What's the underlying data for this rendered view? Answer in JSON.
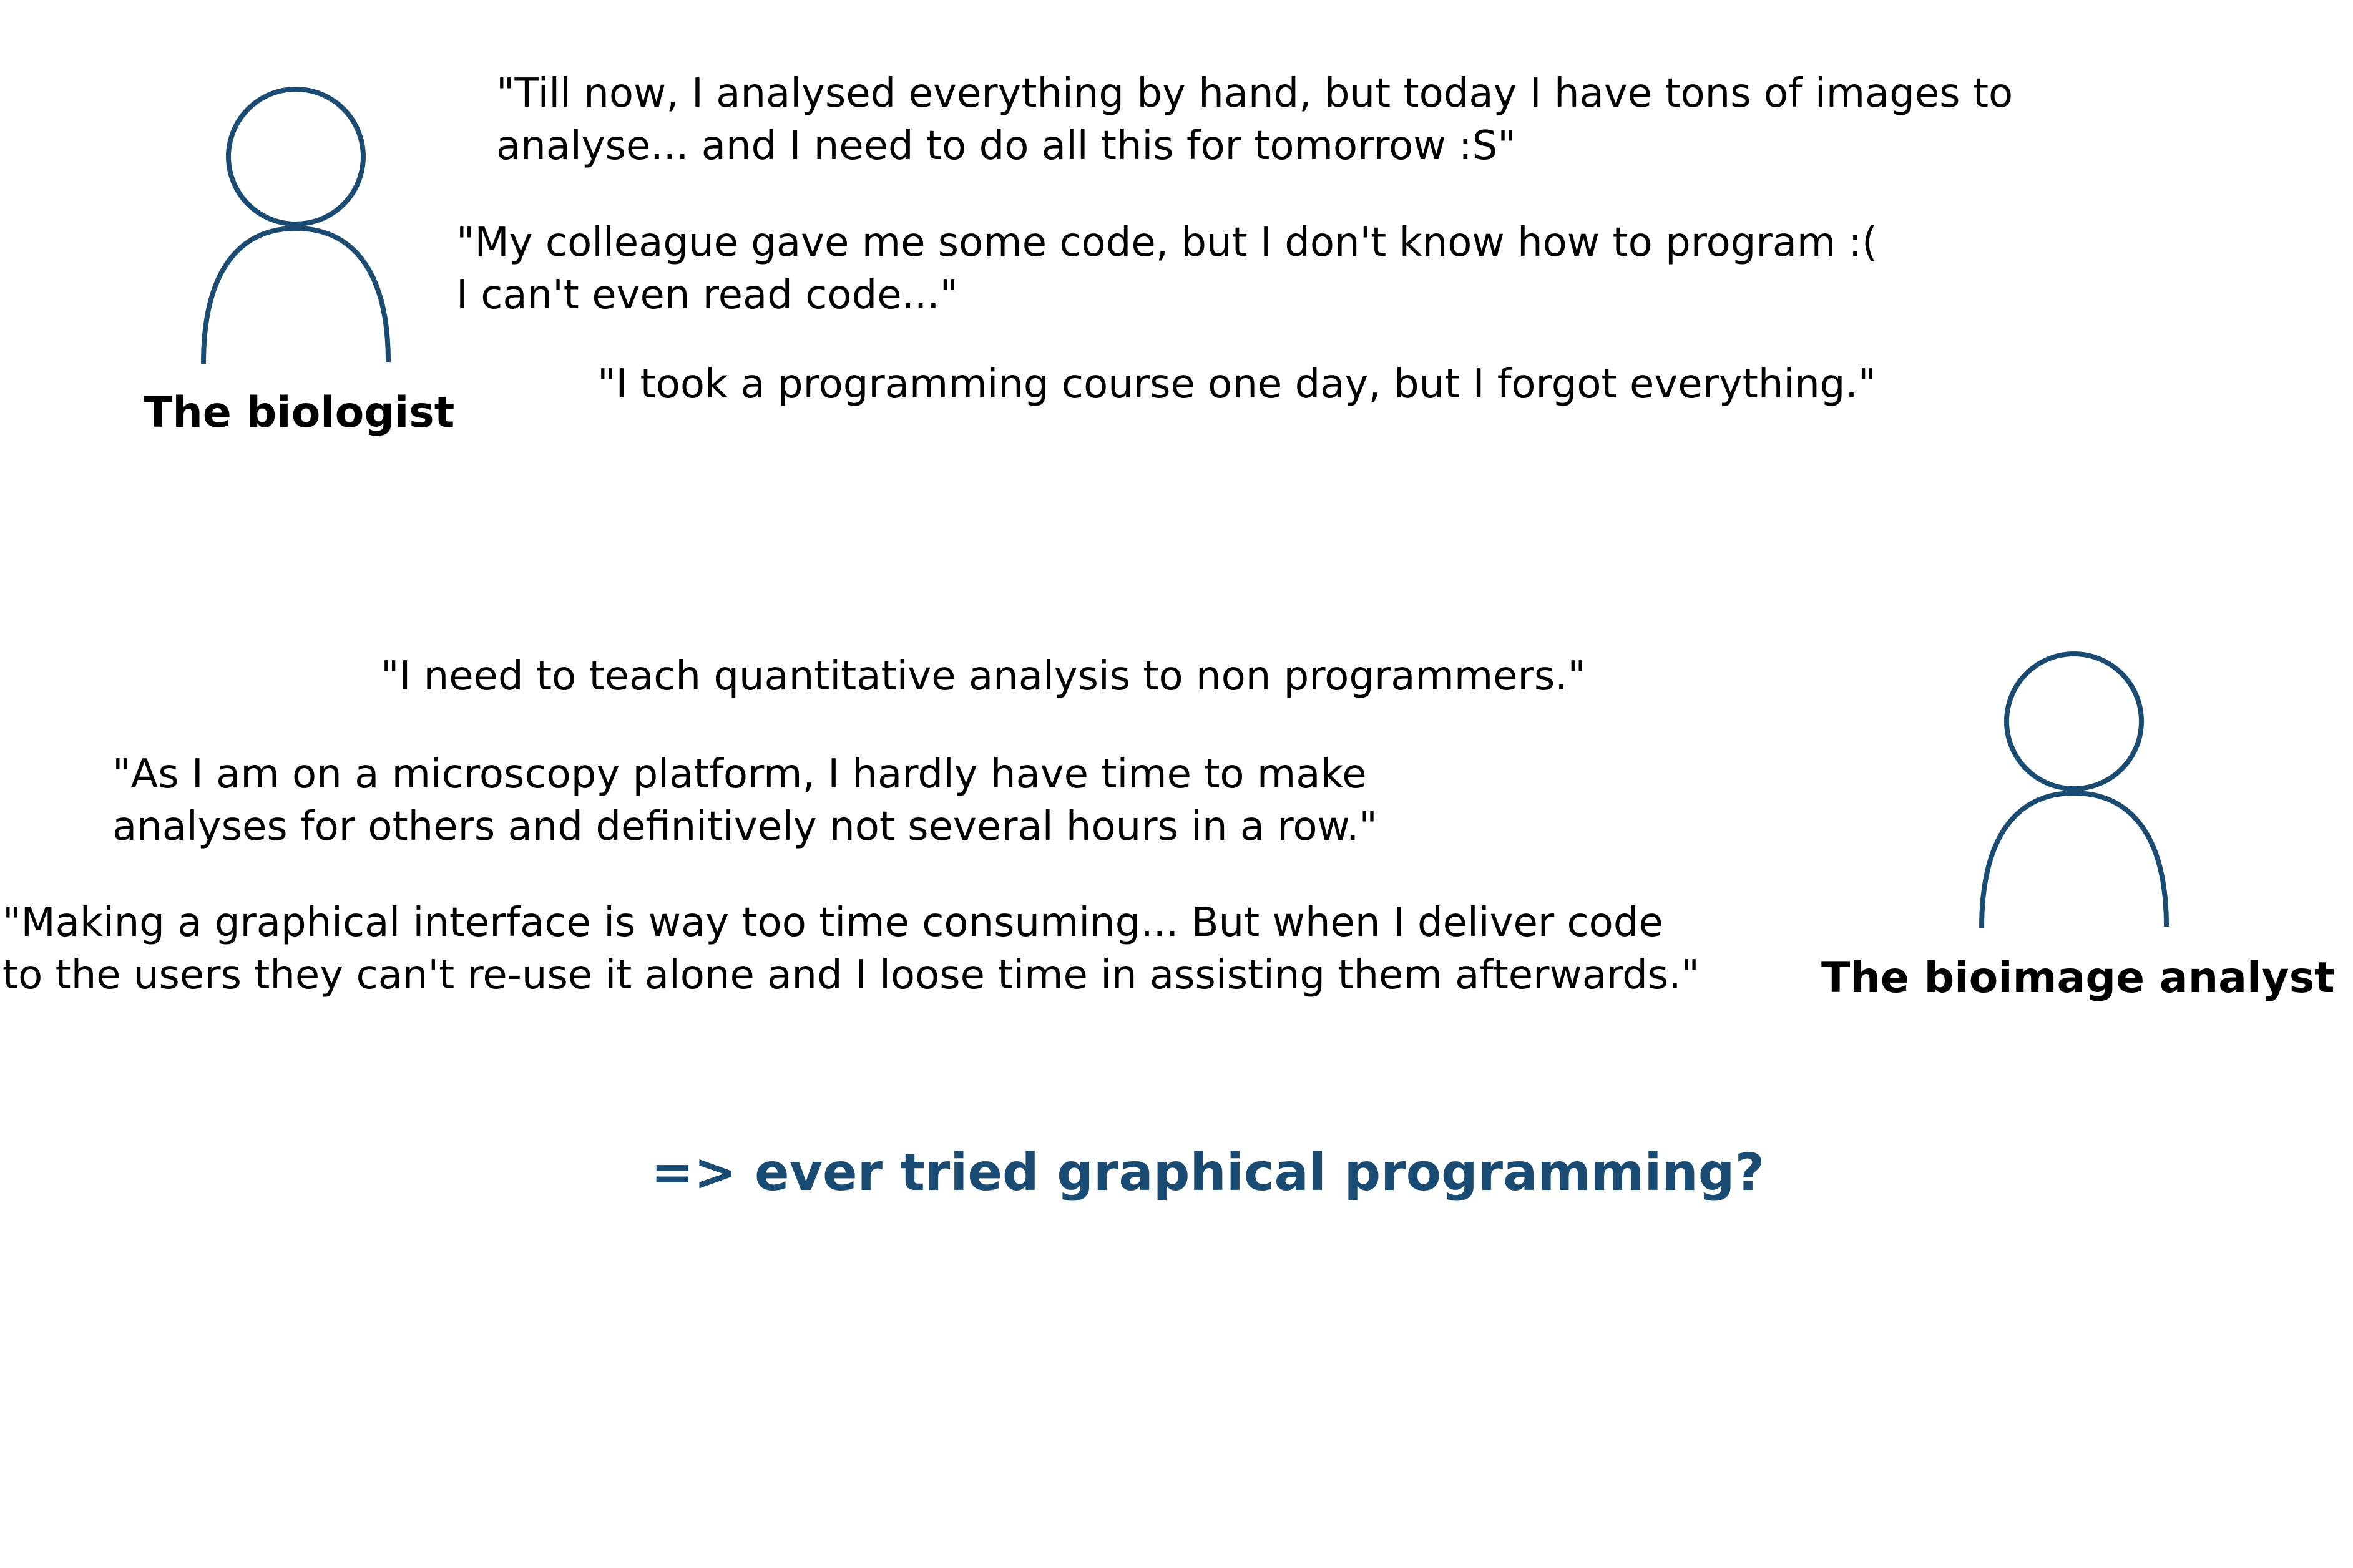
{
  "colors": {
    "accent": "#1a4b72",
    "text": "#000000",
    "background": "#ffffff"
  },
  "biologist": {
    "icon": "person-outline-icon",
    "name": "The biologist",
    "quotes": [
      {
        "lines": [
          "\"Till now, I analysed everything by hand, but today I have tons of images to",
          "analyse... and I need to do all this for tomorrow :S\""
        ]
      },
      {
        "lines": [
          "\"My colleague gave me some code, but I don't know how to program :(",
          "I can't even read code...\""
        ]
      },
      {
        "lines": [
          "\"I took a programming course one day, but I forgot everything.\""
        ]
      }
    ]
  },
  "analyst": {
    "icon": "person-outline-icon",
    "name": "The bioimage analyst",
    "quotes": [
      {
        "lines": [
          "\"I need to teach quantitative analysis to non programmers.\""
        ]
      },
      {
        "lines": [
          "\"As I am on a microscopy platform, I hardly have time to make",
          "analyses for others and definitively not several hours in a row.\""
        ]
      },
      {
        "lines": [
          "\"Making a graphical interface is way too time consuming... But when I deliver code",
          "to the users they can't re-use it alone and I loose time in assisting them afterwards.\""
        ]
      }
    ]
  },
  "conclusion": "=> ever tried graphical programming?"
}
